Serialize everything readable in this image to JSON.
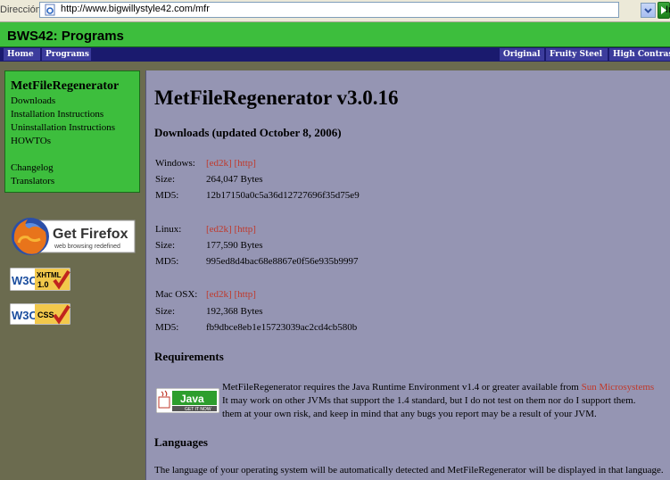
{
  "browser": {
    "address_label": "Dirección",
    "url": "http://www.bigwillystyle42.com/mfr",
    "go_label": "Ir"
  },
  "header": {
    "title": "BWS42: Programs"
  },
  "nav": {
    "left": [
      "Home",
      "Programs"
    ],
    "right": [
      "Original",
      "Fruity Steel",
      "High Contrast"
    ]
  },
  "sidebar": {
    "title": "MetFileRegenerator",
    "links": [
      "Downloads",
      "Installation Instructions",
      "Uninstallation Instructions",
      "HOWTOs",
      "Changelog",
      "Translators"
    ]
  },
  "badges": {
    "firefox_main": "Get Firefox",
    "firefox_sub": "web browsing redefined",
    "xhtml_text": "XHTML",
    "xhtml_version": "1.0",
    "css_text": "CSS",
    "w3c": "W3C"
  },
  "main": {
    "title": "MetFileRegenerator v3.0.16",
    "downloads_heading": "Downloads (updated October 8, 2006)",
    "downloads": [
      {
        "platform": "Windows:",
        "link1": "[ed2k]",
        "link2": "[http]",
        "size_label": "Size:",
        "size": "264,047 Bytes",
        "md5_label": "MD5:",
        "md5": "12b17150a0c5a36d12727696f35d75e9"
      },
      {
        "platform": "Linux:",
        "link1": "[ed2k]",
        "link2": "[http]",
        "size_label": "Size:",
        "size": "177,590 Bytes",
        "md5_label": "MD5:",
        "md5": "995ed8d4bac68e8867e0f56e935b9997"
      },
      {
        "platform": "Mac OSX:",
        "link1": "[ed2k]",
        "link2": "[http]",
        "size_label": "Size:",
        "size": "192,368 Bytes",
        "md5_label": "MD5:",
        "md5": "fb9dbce8eb1e15723039ac2cd4cb580b"
      }
    ],
    "requirements_heading": "Requirements",
    "java_logo_text": "Java",
    "java_logo_sub": "GET IT NOW",
    "requirements_line1": "MetFileRegenerator requires the Java Runtime Environment v1.4 or greater available from ",
    "requirements_link": "Sun Microsystems",
    "requirements_line2": "It may work on other JVMs that support the 1.4 standard, but I do not test on them nor do I support them.",
    "requirements_line3": "them at your own risk, and keep in mind that any bugs you report may be a result of your JVM.",
    "languages_heading": "Languages",
    "languages_text": "The language of your operating system will be automatically detected and MetFileRegenerator will be displayed in that language."
  },
  "colors": {
    "header_green": "#3dbe3d",
    "nav_blue": "#1a1a6e",
    "nav_item": "#3c3c9c",
    "content_bg": "#9595b3",
    "page_bg": "#6b6b4f",
    "link_red": "#c0392b"
  }
}
